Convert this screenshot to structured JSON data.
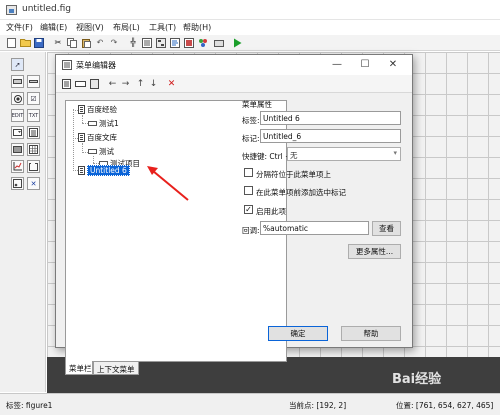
{
  "window": {
    "title": "untitled.fig"
  },
  "menu": [
    "文件(F)",
    "编辑(E)",
    "视图(V)",
    "布局(L)",
    "工具(T)",
    "帮助(H)"
  ],
  "dialog": {
    "title": "菜单编辑器",
    "tree": {
      "items": [
        {
          "label": "百度经验",
          "type": "menu"
        },
        {
          "label": "测试1",
          "type": "item"
        },
        {
          "label": "百度文库",
          "type": "menu"
        },
        {
          "label": "测试",
          "type": "item"
        },
        {
          "label": "测试项目",
          "type": "item"
        },
        {
          "label": "Untitled 6",
          "type": "menu",
          "selected": true
        }
      ]
    },
    "tabs": [
      "菜单栏",
      "上下文菜单"
    ],
    "props": {
      "section_title": "菜单属性",
      "label_caption": "标签:",
      "label_value": "Untitled 6",
      "tag_caption": "标记:",
      "tag_value": "Untitled_6",
      "shortcut_caption": "快捷键: Ctrl +",
      "shortcut_value": "无",
      "separator_caption": "分隔符位于此菜单项上",
      "separator_checked": false,
      "check_caption": "在此菜单项前添加选中标记",
      "check_checked": false,
      "enable_caption": "启用此项",
      "enable_checked": true,
      "callback_caption": "回调:",
      "callback_value": "%automatic",
      "view_button": "查看",
      "more_button": "更多属性..."
    },
    "ok_button": "确定",
    "help_button": "帮助"
  },
  "status": {
    "tag": "标签: figure1",
    "current_point": "当前点:   [192, 2]",
    "position": "位置: [761, 654, 627, 465]"
  },
  "watermark": "Bai经验"
}
